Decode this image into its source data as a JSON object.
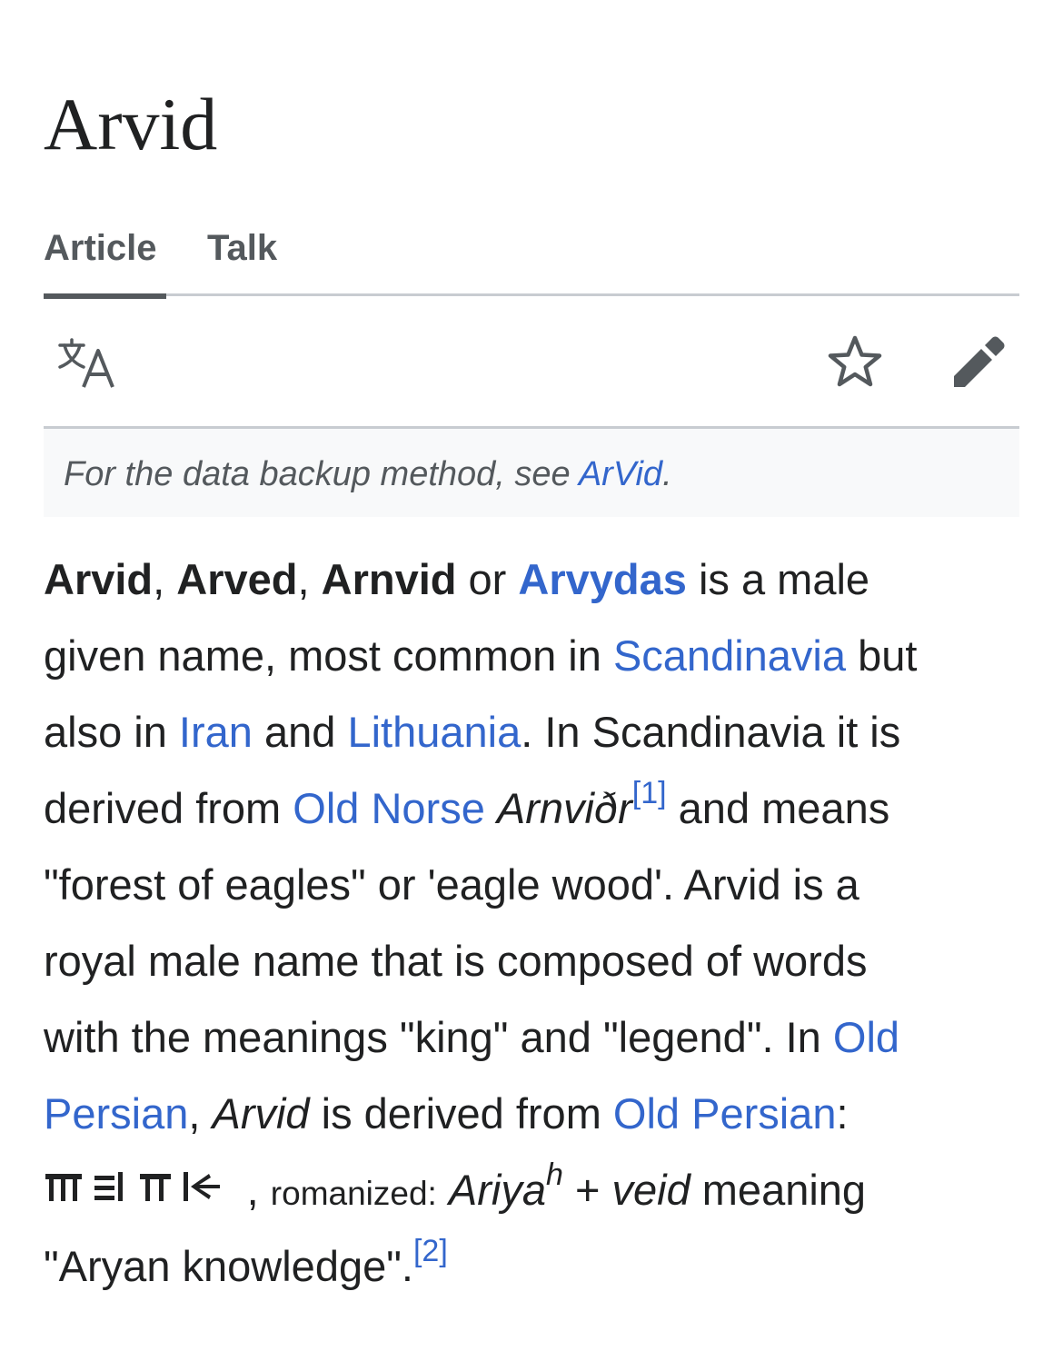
{
  "page": {
    "title": "Arvid"
  },
  "tabs": [
    {
      "label": "Article"
    },
    {
      "label": "Talk"
    }
  ],
  "toolbar": {
    "language_icon": "translate-icon",
    "watch_icon": "star-icon",
    "edit_icon": "pencil-icon"
  },
  "hatnote": {
    "prefix": "For the data backup method, see ",
    "link": "ArVid",
    "suffix": "."
  },
  "paragraph": {
    "l1": {
      "b1": "Arvid",
      "s1": ", ",
      "b2": "Arved",
      "s2": ", ",
      "b3": "Arnvid",
      "s3": " or ",
      "link": "Arvydas",
      "s4": " is a male"
    },
    "l2": {
      "t1": "given name, most common in ",
      "link": "Scandinavia",
      "t2": " but"
    },
    "l3": {
      "t1": "also in ",
      "link1": "Iran",
      "t2": " and ",
      "link2": "Lithuania",
      "t3": ". In Scandinavia it is"
    },
    "l4": {
      "t1": "derived from ",
      "link": "Old Norse",
      "t2": " ",
      "italic": "Arnviðr",
      "ref": "[1]",
      "t3": " and means"
    },
    "l5": {
      "t1": "\"forest of eagles\" or 'eagle wood'. Arvid is a"
    },
    "l6": {
      "t1": "royal male name that is composed of words"
    },
    "l7": {
      "t1": "with the meanings \"king\" and \"legend\". In ",
      "link": "Old"
    },
    "l8": {
      "link1": "Persian",
      "t1": ", ",
      "italic": "Arvid",
      "t2": " is derived from ",
      "link2": "Old Persian",
      "t3": ":"
    },
    "l9": {
      "cuneiform": "𐎠𐎼𐎡𐎹",
      "t1": ", ",
      "small": "romanized:",
      "t2": " ",
      "italic1": "Ariya",
      "sup": "h",
      "t3": " + ",
      "italic2": "veid",
      "t4": " meaning"
    },
    "l10": {
      "t1": "\"Aryan knowledge\".",
      "ref": "[2]"
    }
  }
}
